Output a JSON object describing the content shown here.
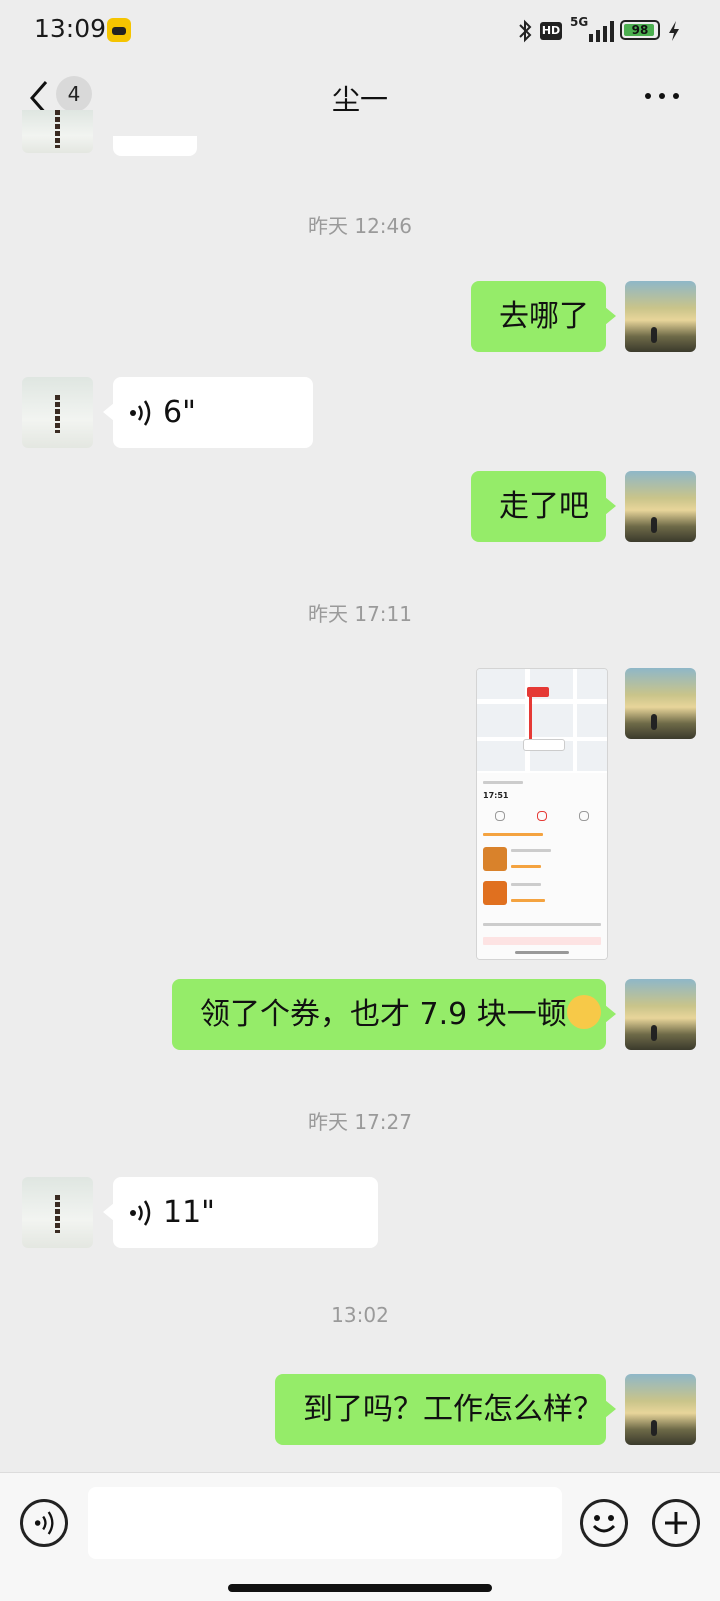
{
  "status_bar": {
    "time": "13:09",
    "network": "5G",
    "hd": "HD",
    "battery": "98",
    "app_icon": "taxi-app-icon",
    "icons": [
      "bluetooth-icon",
      "hd-icon",
      "signal-icon",
      "battery-icon",
      "charging-icon"
    ]
  },
  "header": {
    "unread_count": "4",
    "title": "尘一",
    "back_icon": "chevron-left-icon",
    "more_icon": "more-dots-icon"
  },
  "messages": {
    "ts1": "昨天 12:46",
    "m1": "去哪了",
    "v1": "6\"",
    "m2": "走了吧",
    "ts2": "昨天 17:11",
    "m4": "领了个券，也才 7.9 块一顿",
    "m4_emoji": "laughing-tears-emoji",
    "ts3": "昨天 17:27",
    "v2": "11\"",
    "ts4": "13:02",
    "m5": "到了吗？工作怎么样？",
    "image_screenshot": {
      "eta": "17:51"
    }
  },
  "colors": {
    "sent_bubble": "#95ec69",
    "received_bubble": "#ffffff",
    "background": "#ededed"
  },
  "input_bar": {
    "voice_icon": "voice-input-icon",
    "emoji_icon": "emoji-icon",
    "plus_icon": "plus-icon"
  }
}
